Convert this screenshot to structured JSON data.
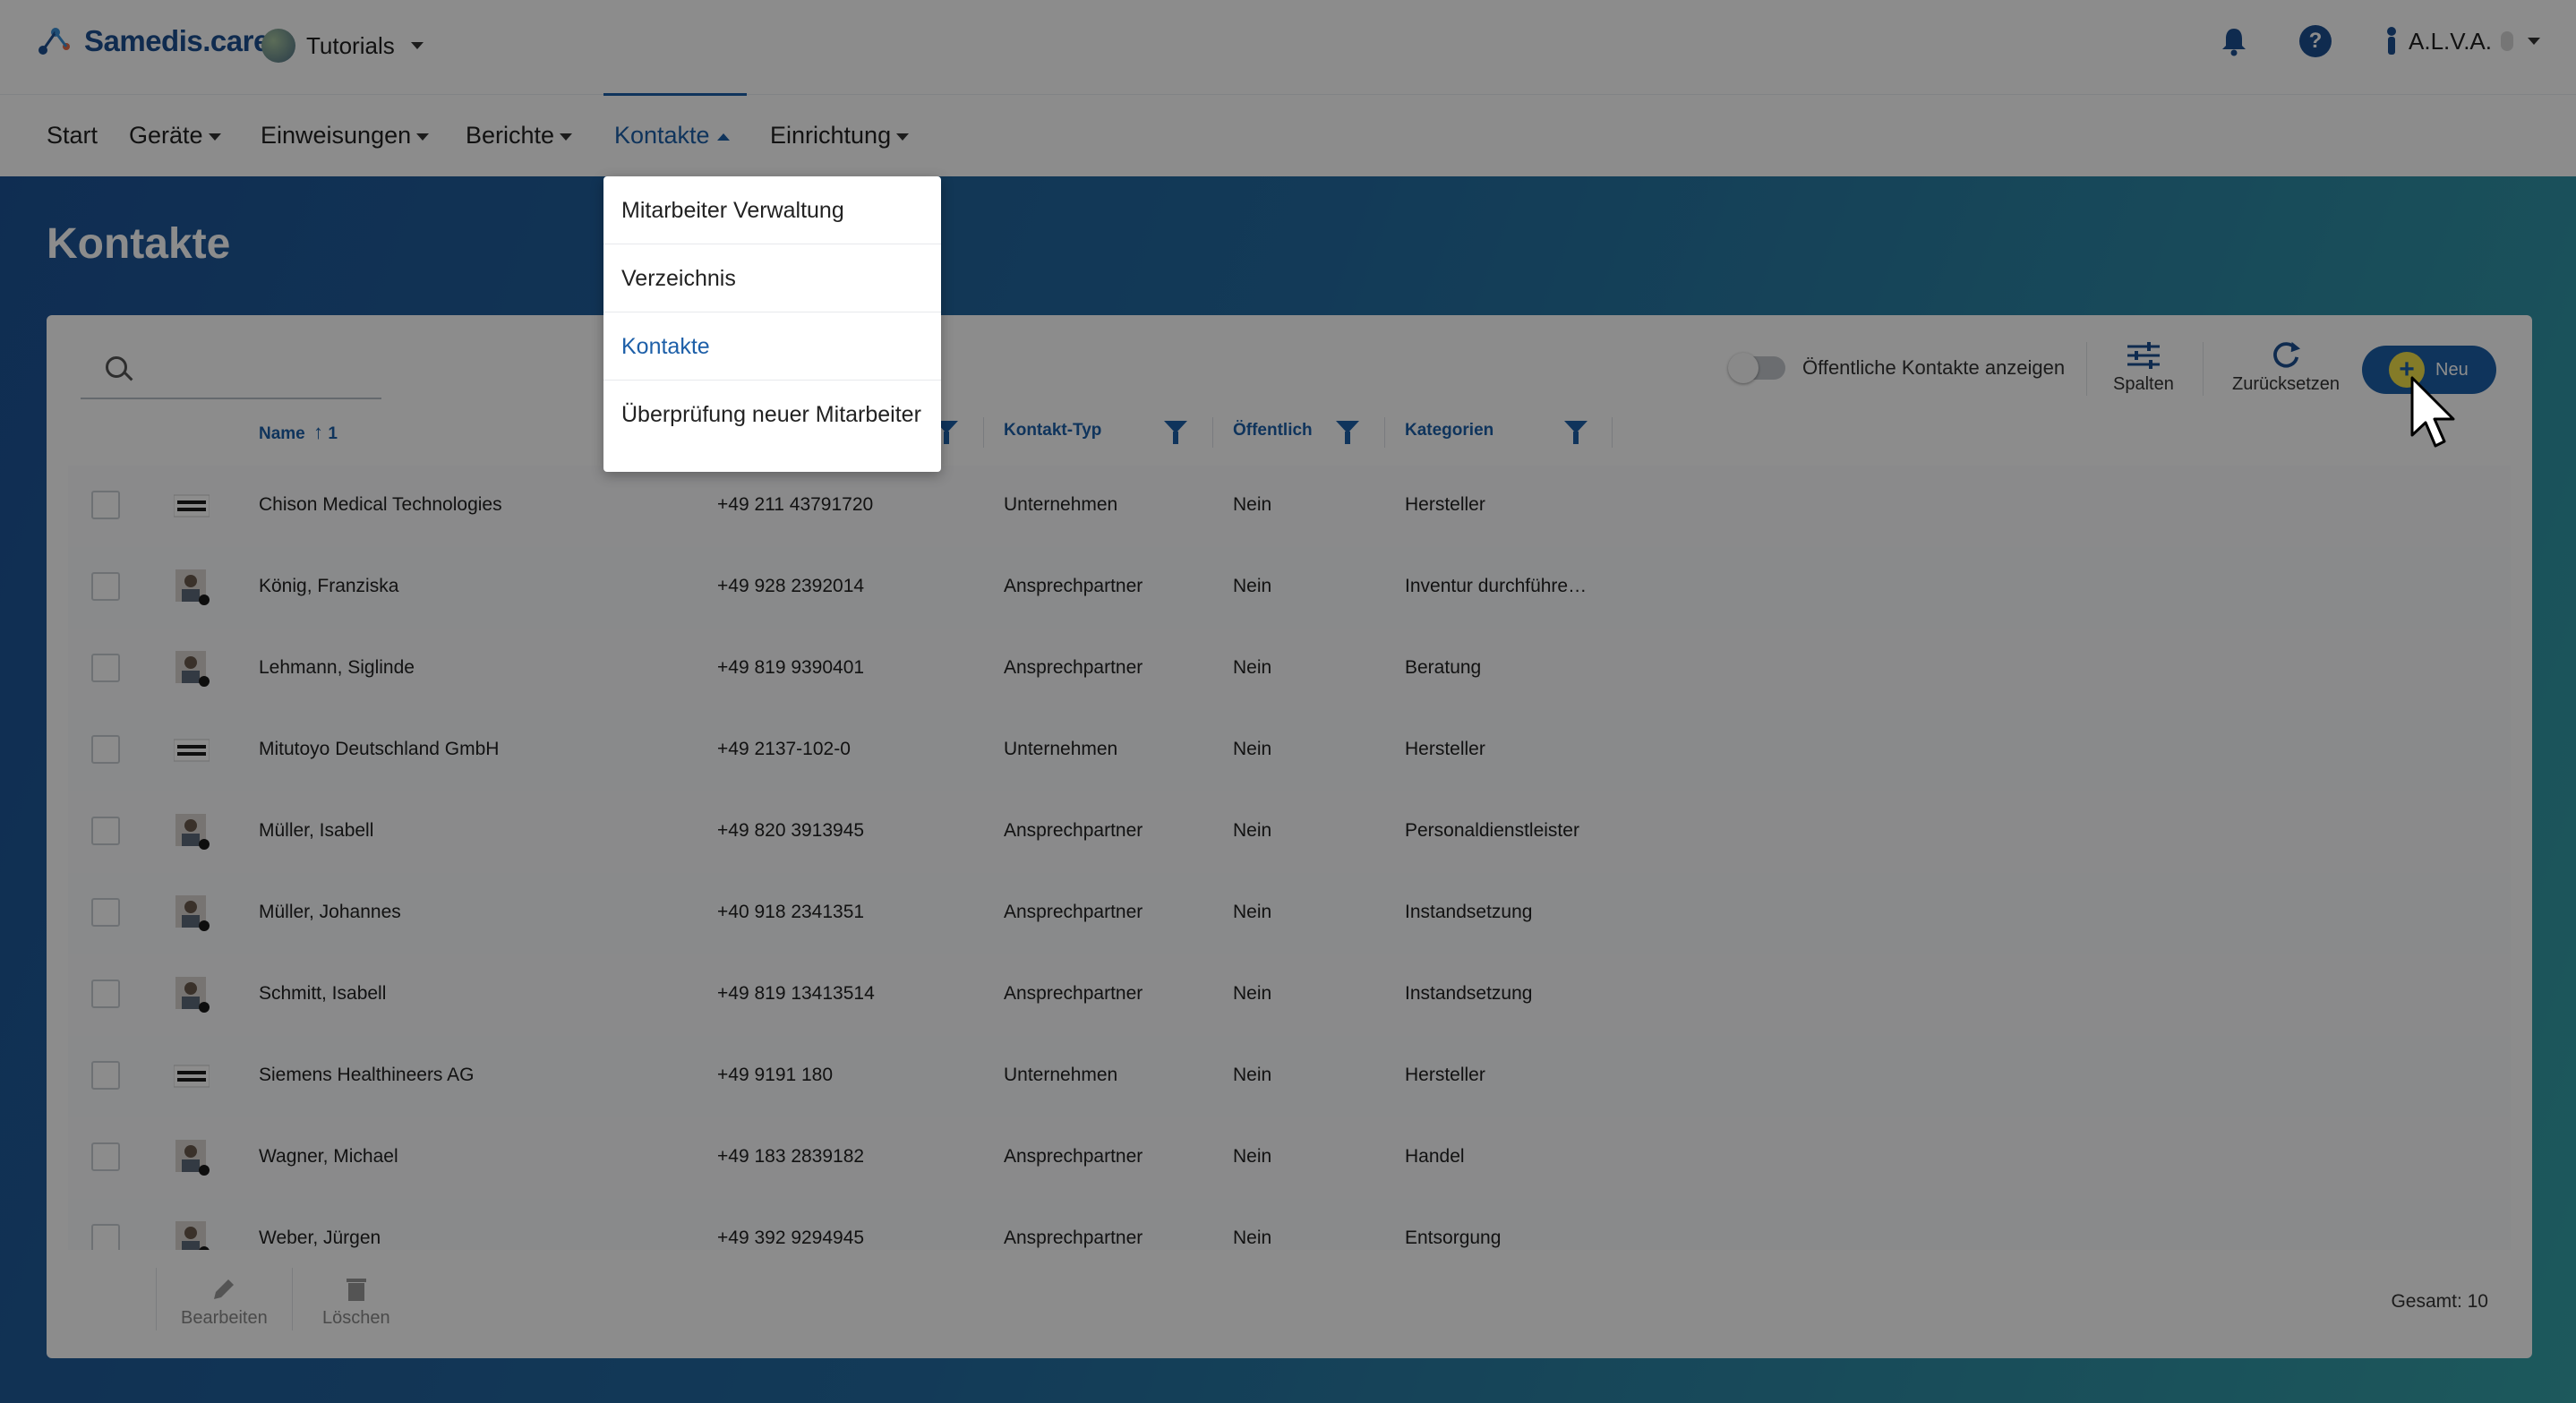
{
  "app": {
    "logo_text": "Samedis.care",
    "workspace": "Tutorials",
    "user": "A.L.V.A."
  },
  "nav": {
    "items": [
      {
        "label": "Start",
        "has_caret": false
      },
      {
        "label": "Geräte",
        "has_caret": true
      },
      {
        "label": "Einweisungen",
        "has_caret": true
      },
      {
        "label": "Berichte",
        "has_caret": true
      },
      {
        "label": "Kontakte",
        "has_caret": true,
        "active": true
      },
      {
        "label": "Einrichtung",
        "has_caret": true
      }
    ]
  },
  "dropdown": {
    "items": [
      {
        "label": "Mitarbeiter Verwaltung"
      },
      {
        "label": "Verzeichnis"
      },
      {
        "label": "Kontakte",
        "active": true
      },
      {
        "label": "Überprüfung neuer Mitarbeiter"
      }
    ]
  },
  "page": {
    "title": "Kontakte"
  },
  "toolbar": {
    "search_placeholder": "",
    "public_toggle_label": "Öffentliche Kontakte anzeigen",
    "columns_label": "Spalten",
    "reset_label": "Zurücksetzen",
    "new_label": "Neu"
  },
  "table": {
    "headers": {
      "name": "Name",
      "sort_index": "1",
      "contact_type": "Kontakt-Typ",
      "public": "Öffentlich",
      "categories": "Kategorien"
    },
    "rows": [
      {
        "name": "Chison Medical Technologies",
        "phone": "+49 211 43791720",
        "type": "Unternehmen",
        "public": "Nein",
        "category": "Hersteller",
        "avatar": "company-logo"
      },
      {
        "name": "König, Franziska",
        "phone": "+49 928 2392014",
        "type": "Ansprechpartner",
        "public": "Nein",
        "category": "Inventur durchführe…",
        "avatar": "person"
      },
      {
        "name": "Lehmann, Siglinde",
        "phone": "+49 819 9390401",
        "type": "Ansprechpartner",
        "public": "Nein",
        "category": "Beratung",
        "avatar": "person"
      },
      {
        "name": "Mitutoyo Deutschland GmbH",
        "phone": "+49 2137-102-0",
        "type": "Unternehmen",
        "public": "Nein",
        "category": "Hersteller",
        "avatar": "company-logo"
      },
      {
        "name": "Müller, Isabell",
        "phone": "+49 820 3913945",
        "type": "Ansprechpartner",
        "public": "Nein",
        "category": "Personaldienstleister",
        "avatar": "person"
      },
      {
        "name": "Müller, Johannes",
        "phone": "+40 918 2341351",
        "type": "Ansprechpartner",
        "public": "Nein",
        "category": "Instandsetzung",
        "avatar": "person"
      },
      {
        "name": "Schmitt, Isabell",
        "phone": "+49 819 13413514",
        "type": "Ansprechpartner",
        "public": "Nein",
        "category": "Instandsetzung",
        "avatar": "person"
      },
      {
        "name": "Siemens Healthineers AG",
        "phone": "+49 9191 180",
        "type": "Unternehmen",
        "public": "Nein",
        "category": "Hersteller",
        "avatar": "company-logo"
      },
      {
        "name": "Wagner, Michael",
        "phone": "+49 183 2839182",
        "type": "Ansprechpartner",
        "public": "Nein",
        "category": "Handel",
        "avatar": "person"
      },
      {
        "name": "Weber, Jürgen",
        "phone": "+49 392 9294945",
        "type": "Ansprechpartner",
        "public": "Nein",
        "category": "Entsorgung",
        "avatar": "person"
      }
    ]
  },
  "footer": {
    "edit_label": "Bearbeiten",
    "delete_label": "Löschen",
    "total": "Gesamt: 10"
  },
  "colors": {
    "brand": "#1d5fa8",
    "accent": "#f0e04a"
  }
}
